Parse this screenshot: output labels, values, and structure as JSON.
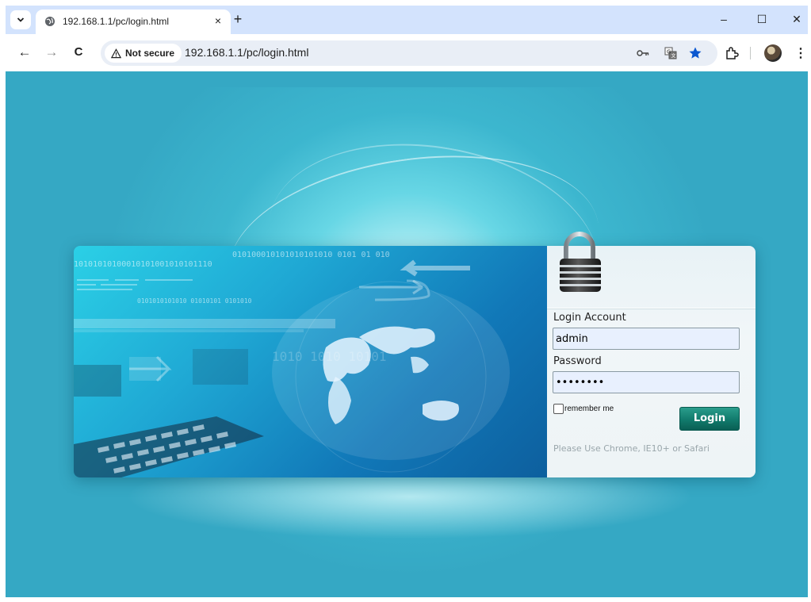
{
  "browser": {
    "tab": {
      "title": "192.168.1.1/pc/login.html",
      "close": "×"
    },
    "new_tab": "+",
    "window_controls": {
      "minimize": "–",
      "maximize": "☐",
      "close": "✕"
    },
    "nav": {
      "back": "←",
      "forward": "→",
      "reload": "C"
    },
    "security": {
      "label": "Not secure",
      "icon": "warning-triangle-icon"
    },
    "url": "192.168.1.1/pc/login.html",
    "menu": "⋮",
    "icons": [
      "password-key-icon",
      "translate-icon",
      "bookmark-star-icon",
      "extensions-icon",
      "profile-avatar"
    ]
  },
  "art": {
    "binary_line_1": "010100010101010101010   0101   01 010",
    "binary_line_2": "10101010100010101001010101110",
    "binary_line_3": "0101010101010  01010101  0101010",
    "binary_line_4": "1010 1010  10101"
  },
  "login": {
    "account_label": "Login Account",
    "account_value": "admin",
    "password_label": "Password",
    "password_value": "••••••••",
    "remember_label": "remember me",
    "remember_checked": false,
    "submit_label": "Login",
    "hint": "Please Use Chrome, IE10+ or Safari"
  },
  "colors": {
    "page_bg": "#35a8c4",
    "tab_strip": "#d3e3fd",
    "login_button": "#117a6c",
    "bookmark_star": "#0b57d0"
  }
}
